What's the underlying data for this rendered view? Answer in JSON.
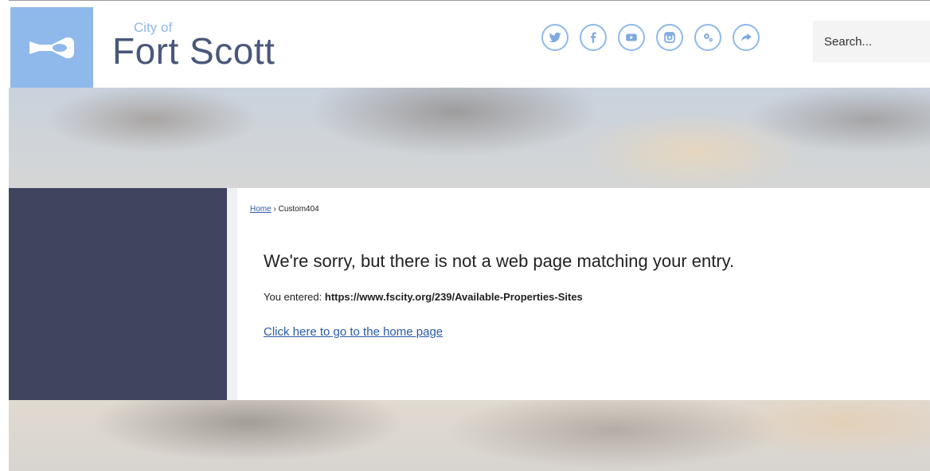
{
  "header": {
    "brand_small": "City of",
    "brand_big": "Fort Scott",
    "logo_icon": "bugle-icon",
    "social_icons": [
      "twitter-icon",
      "facebook-icon",
      "youtube-icon",
      "instagram-icon",
      "gears-icon",
      "share-icon"
    ],
    "search_placeholder": "Search..."
  },
  "breadcrumb": {
    "home": "Home",
    "separator": "›",
    "current": "Custom404"
  },
  "main": {
    "headline": "We're sorry, but there is not a web page matching your entry.",
    "entered_label": "You entered:",
    "entered_url": "https://www.fscity.org/239/Available-Properties-Sites",
    "home_link": "Click here to go to the home page"
  },
  "colors": {
    "logo_bg": "#8fb9ea",
    "brand_text": "#49577a",
    "sidebar": "#40445f",
    "link": "#2a5ba8"
  }
}
